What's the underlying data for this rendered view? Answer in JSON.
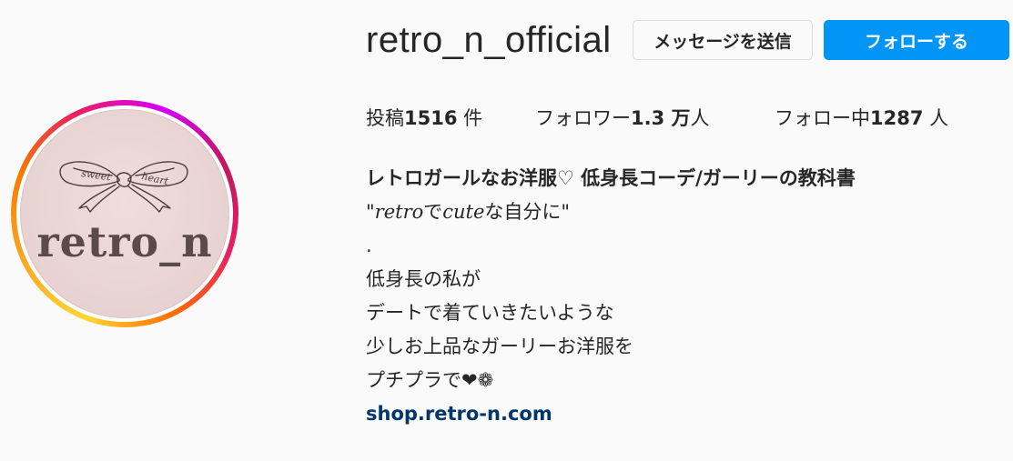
{
  "profile": {
    "username": "retro_n_official",
    "avatar_text": "retro_n",
    "avatar_bow_text_left": "sweet",
    "avatar_bow_text_right": "heart"
  },
  "actions": {
    "message_label": "メッセージを送信",
    "follow_label": "フォローする"
  },
  "stats": {
    "posts_prefix": "投稿",
    "posts_count": "1516",
    "posts_suffix": " 件",
    "followers_prefix": "フォロワー",
    "followers_count": "1.3 万",
    "followers_suffix": "人",
    "following_prefix": "フォロー中",
    "following_count": "1287",
    "following_suffix": " 人"
  },
  "bio": {
    "name": "レトロガールなお洋服♡ 低身長コーデ/ガーリーの教科書",
    "line1_a": "\"",
    "line1_b": "retro",
    "line1_c": "で",
    "line1_d": "cute",
    "line1_e": "な自分に\"",
    "line2": ".",
    "line3": "低身長の私が",
    "line4": "デートで着ていきたいような",
    "line5": "少しお上品なガーリーお洋服を",
    "line6": "プチプラで❤︎❁",
    "link": "shop.retro-n.com"
  },
  "colors": {
    "follow_button": "#0095f6",
    "link": "#00376b",
    "background": "#fafafa"
  }
}
